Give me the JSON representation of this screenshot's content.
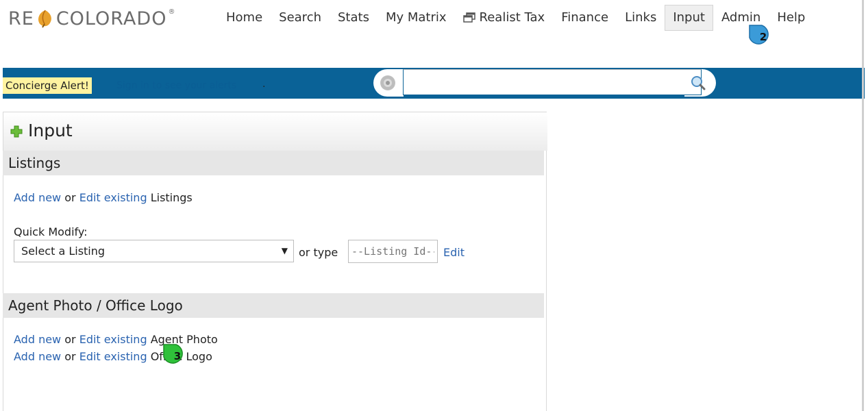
{
  "header": {
    "logo_left": "RE",
    "logo_right": "COLORADO",
    "logo_reg": "®",
    "nav": [
      {
        "label": "Home"
      },
      {
        "label": "Search"
      },
      {
        "label": "Stats"
      },
      {
        "label": "My Matrix"
      },
      {
        "label": "Realist Tax",
        "icon": "external-window-icon"
      },
      {
        "label": "Finance"
      },
      {
        "label": "Links"
      },
      {
        "label": "Input",
        "active": true
      },
      {
        "label": "Admin"
      },
      {
        "label": "Help"
      }
    ]
  },
  "callouts": {
    "nav": "2",
    "content": "3"
  },
  "topbar": {
    "concierge_alert": "Concierge Alert!",
    "concierge_link": "Sign in to see your alerts",
    "concierge_end": ".",
    "search_placeholder": "",
    "search_value": ""
  },
  "panel": {
    "title": "Input",
    "listings": {
      "heading": "Listings",
      "add_new": "Add new",
      "or": "or",
      "edit_existing": "Edit existing",
      "suffix": "Listings",
      "quick_modify_label": "Quick Modify:",
      "select_value": "Select a Listing",
      "or_type": "or type",
      "listing_id_placeholder": "--Listing Id--",
      "edit": "Edit"
    },
    "photo": {
      "heading": "Agent Photo / Office Logo",
      "row1": {
        "add_new": "Add new",
        "or": "or",
        "edit_existing": "Edit existing",
        "suffix": "Agent Photo"
      },
      "row2": {
        "add_new": "Add new",
        "or": "or",
        "edit_existing": "Edit existing",
        "suffix": "Office Logo"
      }
    }
  },
  "colors": {
    "brand_blue": "#0a6297",
    "link_blue": "#2a63b0",
    "alert_yellow": "#fff3a0",
    "callout_blue": "#3b9bd8",
    "callout_green": "#2fc13a"
  }
}
